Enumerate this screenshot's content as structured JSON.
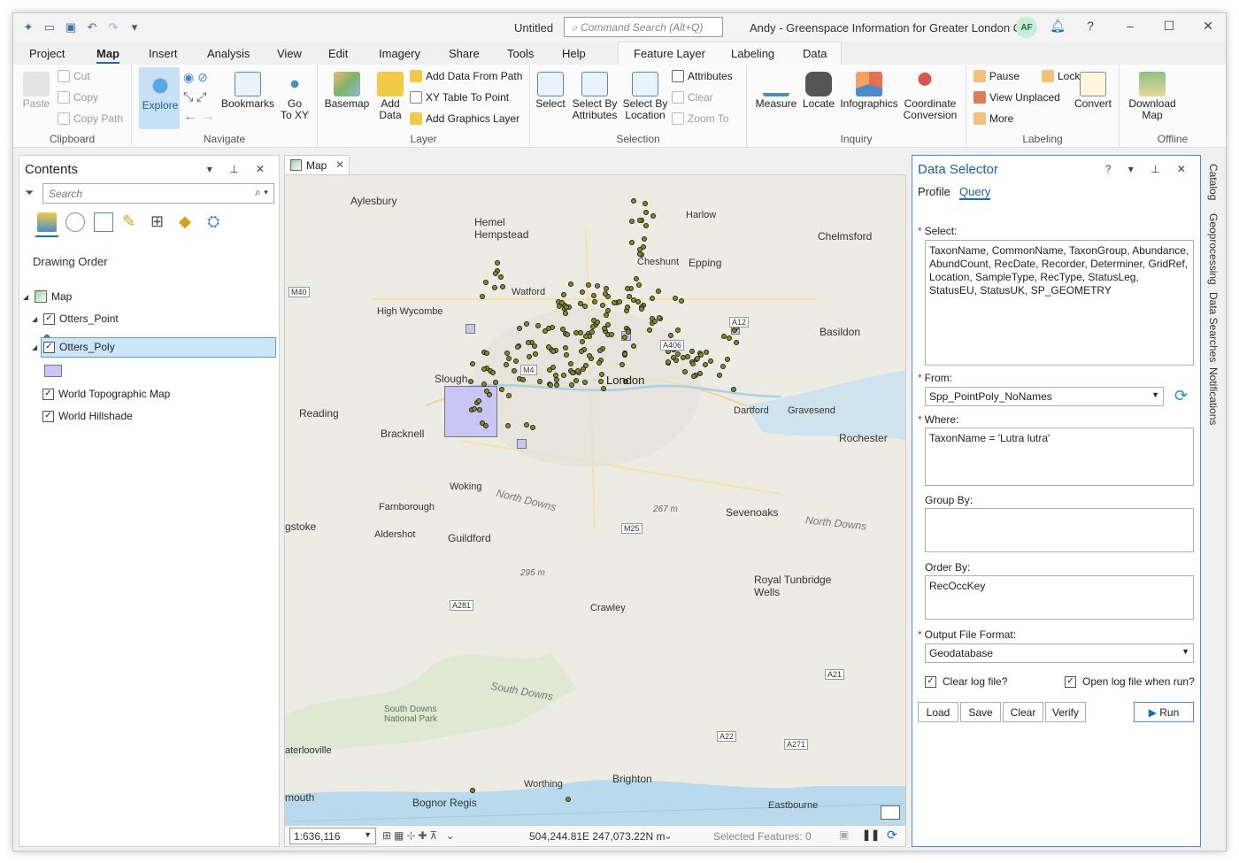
{
  "titlebar": {
    "doc_title": "Untitled",
    "command_search_placeholder": "Command Search (Alt+Q)",
    "user": "Andy - Greenspace Information for Greater London CIC",
    "avatar_initials": "AF"
  },
  "menu_tabs": [
    "Project",
    "Map",
    "Insert",
    "Analysis",
    "View",
    "Edit",
    "Imagery",
    "Share",
    "Tools",
    "Help"
  ],
  "context_tabs": [
    "Feature Layer",
    "Labeling",
    "Data"
  ],
  "ribbon": {
    "clipboard": {
      "label": "Clipboard",
      "paste": "Paste",
      "cut": "Cut",
      "copy": "Copy",
      "copy_path": "Copy Path"
    },
    "navigate": {
      "label": "Navigate",
      "explore": "Explore",
      "bookmarks": "Bookmarks",
      "go_to_xy_1": "Go",
      "go_to_xy_2": "To XY"
    },
    "layer": {
      "label": "Layer",
      "basemap": "Basemap",
      "add_data_1": "Add",
      "add_data_2": "Data",
      "add_data_from_path": "Add Data From Path",
      "xy_table": "XY Table To Point",
      "add_graphics": "Add Graphics Layer"
    },
    "selection": {
      "label": "Selection",
      "select": "Select",
      "select_by_attr_1": "Select By",
      "select_by_attr_2": "Attributes",
      "select_by_loc_1": "Select By",
      "select_by_loc_2": "Location",
      "attributes": "Attributes",
      "clear": "Clear",
      "zoom_to": "Zoom To"
    },
    "inquiry": {
      "label": "Inquiry",
      "measure": "Measure",
      "locate": "Locate",
      "infographics": "Infographics",
      "coord_1": "Coordinate",
      "coord_2": "Conversion"
    },
    "labeling": {
      "label": "Labeling",
      "pause": "Pause",
      "lock": "Lock",
      "view_unplaced": "View Unplaced",
      "more": "More",
      "convert": "Convert"
    },
    "offline": {
      "label": "Offline",
      "download_1": "Download",
      "download_2": "Map"
    }
  },
  "contents": {
    "title": "Contents",
    "search_placeholder": "Search",
    "drawing_order": "Drawing Order",
    "layers": [
      "Map",
      "Otters_Point",
      "Otters_Poly",
      "World Topographic Map",
      "World Hillshade"
    ]
  },
  "map": {
    "tab": "Map",
    "scale": "1:636,116",
    "coords": "504,244.81E 247,073.22N m",
    "selected_features": "Selected Features: 0",
    "places": {
      "aylesbury": "Aylesbury",
      "hemel": "Hemel\nHempstead",
      "harlow": "Harlow",
      "chelmsford": "Chelmsford",
      "cheshunt": "Cheshunt",
      "epping": "Epping",
      "watford": "Watford",
      "high_wycombe": "High Wycombe",
      "basildon": "Basildon",
      "slough": "Slough",
      "london": "London",
      "reading": "Reading",
      "dartford": "Dartford",
      "gravesend": "Gravesend",
      "bracknell": "Bracknell",
      "rochester": "Rochester",
      "woking": "Woking",
      "north_downs": "North Downs",
      "farnborough": "Farnborough",
      "sevenoaks": "Sevenoaks",
      "north_downs_2": "North Downs",
      "basingstoke": "gstoke",
      "aldershot": "Aldershot",
      "guildford": "Guildford",
      "tunbridge": "Royal Tunbridge\nWells",
      "crawley": "Crawley",
      "south_downs": "South Downs",
      "sdnp": "South Downs\nNational Park",
      "waterlooville": "aterlooville",
      "brighton": "Brighton",
      "worthing": "Worthing",
      "bognor": "Bognor Regis",
      "eastbourne": "Eastbourne",
      "portsmouth": "mouth",
      "h267": "267 m",
      "h295": "295 m"
    },
    "roads": {
      "m40": "M40",
      "a12": "A12",
      "m25": "M25",
      "a281": "A281",
      "a21": "A21",
      "a22": "A22",
      "a271": "A271",
      "a406": "A406",
      "m4": "M4"
    }
  },
  "data_selector": {
    "title": "Data Selector",
    "tabs": [
      "Profile",
      "Query"
    ],
    "select_label": "Select:",
    "select_value": "TaxonName, CommonName, TaxonGroup, Abundance, AbundCount, RecDate, Recorder, Determiner, GridRef, Location, SampleType, RecType, StatusLeg, StatusEU, StatusUK, SP_GEOMETRY",
    "from_label": "From:",
    "from_value": "Spp_PointPoly_NoNames",
    "where_label": "Where:",
    "where_value": "TaxonName = 'Lutra lutra'",
    "group_by_label": "Group By:",
    "group_by_value": "",
    "order_by_label": "Order By:",
    "order_by_value": "RecOccKey",
    "output_label": "Output File Format:",
    "output_value": "Geodatabase",
    "clear_log": "Clear log file?",
    "open_log": "Open log file when run?",
    "buttons": {
      "load": "Load",
      "save": "Save",
      "clear": "Clear",
      "verify": "Verify",
      "run": "Run"
    }
  },
  "side_tabs": [
    "Catalog",
    "Geoprocessing",
    "Data Searches",
    "Notifications"
  ],
  "colors": {
    "accent": "#1c6bb8",
    "points": "#8a8a1e",
    "poly": "#c9c5f5"
  }
}
